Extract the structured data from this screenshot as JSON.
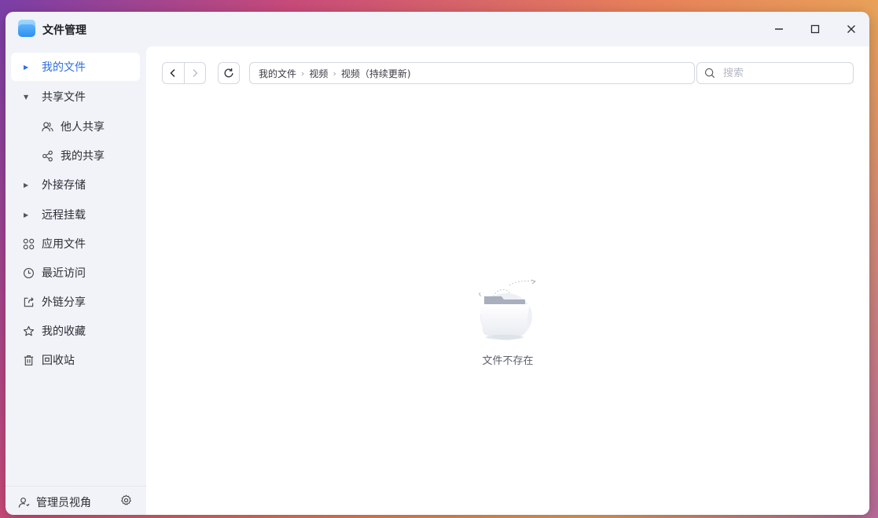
{
  "app": {
    "title": "文件管理",
    "icon": "folder-app-icon"
  },
  "window_controls": {
    "minimize": "—",
    "maximize": "☐",
    "close": "✕"
  },
  "sidebar": {
    "items": [
      {
        "label": "我的文件",
        "icon": "caret-right-icon",
        "active": true
      },
      {
        "label": "共享文件",
        "icon": "caret-down-icon"
      },
      {
        "label": "他人共享",
        "icon": "users-icon",
        "sub": true
      },
      {
        "label": "我的共享",
        "icon": "share-icon",
        "sub": true
      },
      {
        "label": "外接存储",
        "icon": "caret-right-icon"
      },
      {
        "label": "远程挂载",
        "icon": "caret-right-icon"
      },
      {
        "label": "应用文件",
        "icon": "apps-grid-icon"
      },
      {
        "label": "最近访问",
        "icon": "clock-icon"
      },
      {
        "label": "外链分享",
        "icon": "external-share-icon"
      },
      {
        "label": "我的收藏",
        "icon": "star-icon"
      },
      {
        "label": "回收站",
        "icon": "trash-icon"
      }
    ],
    "footer": {
      "label": "管理员视角",
      "icon": "admin-user-icon",
      "settings_icon": "gear-icon"
    }
  },
  "toolbar": {
    "breadcrumb": [
      "我的文件",
      "视频",
      "视频（持续更新)"
    ],
    "search_placeholder": "搜索"
  },
  "main": {
    "empty_text": "文件不存在"
  },
  "colors": {
    "accent": "#2f6fe0",
    "sidebar_bg": "#f1f3f8",
    "content_bg": "#ffffff"
  }
}
